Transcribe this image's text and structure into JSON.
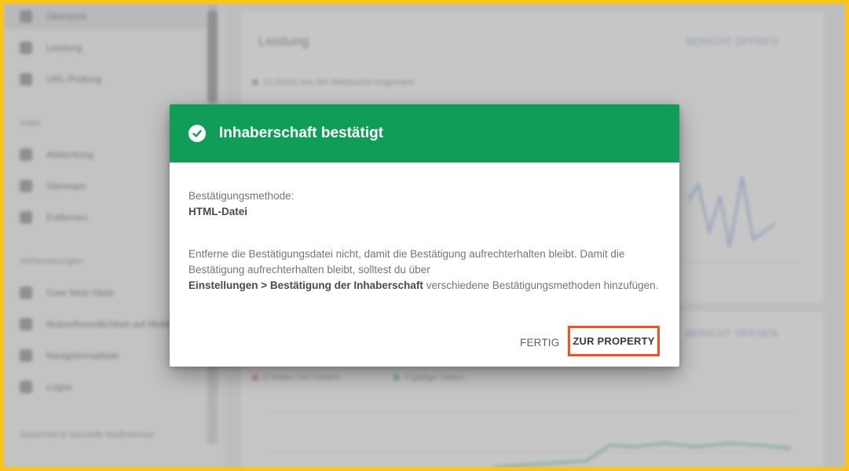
{
  "background": {
    "sidebar": {
      "items_top": [
        {
          "label": "Übersicht",
          "icon": "home-icon"
        },
        {
          "label": "Leistung",
          "icon": "trending-icon"
        },
        {
          "label": "URL-Prüfung",
          "icon": "search-icon"
        }
      ],
      "section_index": "Index",
      "items_index": [
        {
          "label": "Abdeckung",
          "icon": "file-icon"
        },
        {
          "label": "Sitemaps",
          "icon": "sitemap-icon"
        },
        {
          "label": "Entfernen",
          "icon": "eye-off-icon"
        }
      ],
      "section_improvements": "Verbesserungen",
      "items_improvements": [
        {
          "label": "Core Web Vitals",
          "icon": "speed-icon"
        },
        {
          "label": "Nutzerfreundlichkeit auf Mobilgeräten",
          "icon": "phone-icon"
        },
        {
          "label": "Navigationspfade",
          "icon": "breadcrumb-icon"
        },
        {
          "label": "Logos",
          "icon": "logo-icon"
        }
      ],
      "section_security": "Sicherheit & manuelle Maßnahmen"
    },
    "cards": {
      "performance_title": "Leistung",
      "performance_link": "BERICHT ÖFFNEN",
      "performance_note": "21 Klicks aus der Websuche insgesamt",
      "coverage_link": "BERICHT ÖFFNEN",
      "legend_errors": "0 Seiten mit Fehlern",
      "legend_valid": "0 gültige Seiten"
    }
  },
  "dialog": {
    "title": "Inhaberschaft bestätigt",
    "icon": "check-circle-icon",
    "method_label": "Bestätigungsmethode:",
    "method_value": "HTML-Datei",
    "para_part1": "Entferne die Bestätigungsdatei nicht, damit die Bestätigung aufrechterhalten bleibt. Damit die Bestätigung aufrechterhalten bleibt, solltest du über",
    "para_bold": "Einstellungen > Bestätigung der Inhaberschaft",
    "para_part2": " verschiedene Bestätigungsmethoden hinzufügen.",
    "btn_done": "FERTIG",
    "btn_property": "ZUR PROPERTY"
  },
  "colors": {
    "header_green": "#0f9d58",
    "highlight": "#f4511e",
    "frame": "#fcc419"
  }
}
